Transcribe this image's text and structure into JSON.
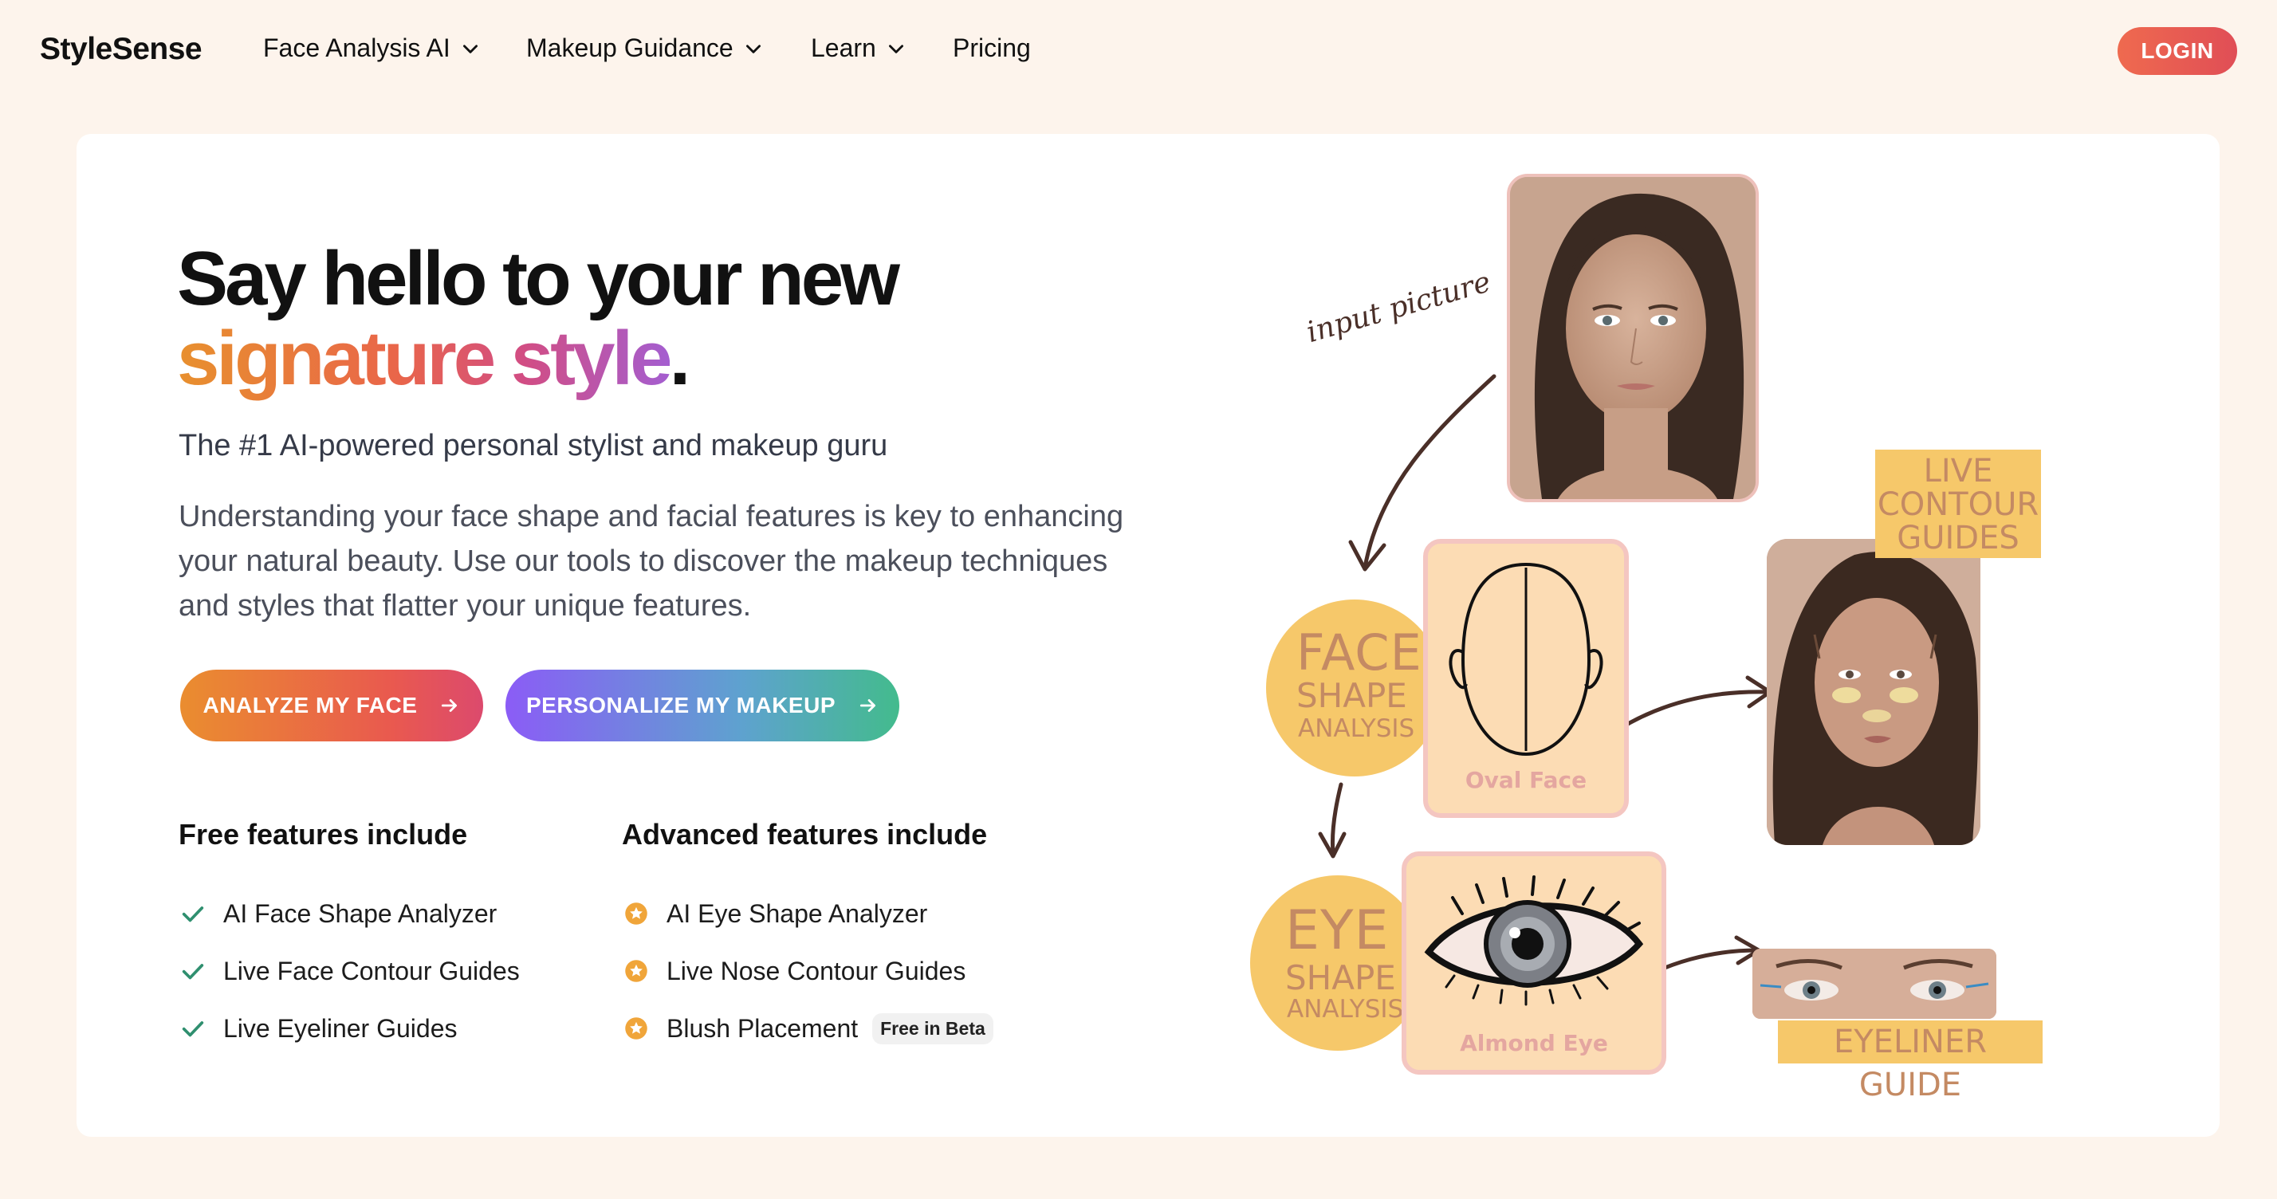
{
  "nav": {
    "logo": "StyleSense",
    "items": [
      {
        "label": "Face Analysis AI",
        "has_dropdown": true
      },
      {
        "label": "Makeup Guidance",
        "has_dropdown": true
      },
      {
        "label": "Learn",
        "has_dropdown": true
      },
      {
        "label": "Pricing",
        "has_dropdown": false
      }
    ],
    "login_label": "LOGIN"
  },
  "hero": {
    "headline_line1": "Say hello to your new",
    "headline_gradient": "signature style",
    "headline_period": ".",
    "subhead": "The #1 AI-powered personal stylist and makeup guru",
    "paragraph": "Understanding your face shape and facial features is key to enhancing your natural beauty. Use our tools to discover the makeup techniques and styles that flatter your unique features.",
    "buttons": {
      "analyze": "ANALYZE MY FACE",
      "personalize": "PERSONALIZE MY MAKEUP"
    }
  },
  "features": {
    "free_title": "Free features include",
    "free_items": [
      "AI Face Shape Analyzer",
      "Live Face Contour Guides",
      "Live Eyeliner Guides"
    ],
    "advanced_title": "Advanced features include",
    "advanced_items": [
      "AI Eye Shape Analyzer",
      "Live Nose Contour Guides",
      "Blush Placement"
    ],
    "beta_badge": "Free in Beta"
  },
  "illustration": {
    "annotation": "input picture",
    "face_circle": {
      "big": "FACE",
      "mid": "SHAPE",
      "small": "ANALYSIS"
    },
    "eye_circle": {
      "big": "EYE",
      "mid": "SHAPE",
      "small": "ANALYSIS"
    },
    "face_box_label": "Oval Face",
    "eye_box_label": "Almond Eye",
    "contour_tag": [
      "LIVE",
      "CONTOUR",
      "GUIDES"
    ],
    "eyeliner_tag": "EYELINER GUIDE"
  },
  "colors": {
    "page_bg": "#fdf4ec",
    "card_bg": "#ffffff",
    "login_bg": "#e85a52",
    "check_green": "#2f8f6f",
    "star_orange": "#f0a53a",
    "circle_yellow": "#f6c86a",
    "box_peach": "#fcdcb4",
    "box_border_pink": "#f4c6c1"
  },
  "icons": {
    "dropdown": "chevron-down-icon",
    "button_arrow": "arrow-right-icon",
    "free_item": "check-icon",
    "advanced_item": "star-circle-icon"
  }
}
